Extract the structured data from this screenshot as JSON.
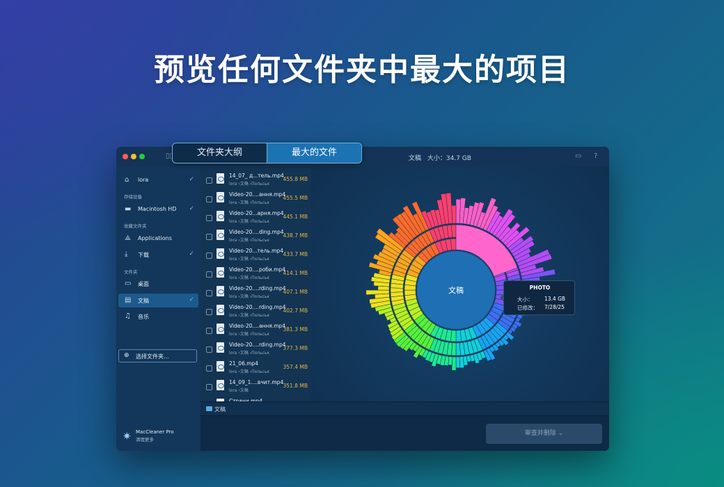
{
  "banner": {
    "title": "预览任何文件夹中最大的项目"
  },
  "window": {
    "tabs": [
      "文件夹大纲",
      "最大的文件"
    ],
    "active_tab": 1,
    "folder_name": "文稿",
    "size_label": "大小：34.7 GB",
    "icons": [
      "sidebar-toggle-icon",
      "chat-bubble-icon",
      "help-icon"
    ]
  },
  "sidebar": {
    "user": {
      "label": "lora",
      "icon": "home-icon",
      "checked": true
    },
    "storage_header": "存储设备",
    "storage": [
      {
        "label": "Macintosh HD",
        "icon": "drive-icon",
        "checked": true
      }
    ],
    "favorites_header": "收藏文件夹",
    "favorites": [
      {
        "label": "Applications",
        "icon": "apps-icon",
        "checked": false
      },
      {
        "label": "下载",
        "icon": "download-icon",
        "checked": true
      }
    ],
    "folders_header": "文件夹",
    "folders": [
      {
        "label": "桌面",
        "icon": "desktop-icon",
        "checked": false
      },
      {
        "label": "文稿",
        "icon": "document-icon",
        "checked": true,
        "selected": true
      },
      {
        "label": "音乐",
        "icon": "music-icon",
        "checked": false
      }
    ],
    "choose_folder": "选择文件夹...",
    "brand_name": "MacCleaner Pro",
    "brand_sub": "清理更多"
  },
  "files": [
    {
      "name": "14_07_ д...тель.mp4",
      "path": "lora ›文稿 ›Польськ",
      "size": "455.8 MB"
    },
    {
      "name": "Video-20....ання.mp4",
      "path": "lora ›文稿 ›Польськ",
      "size": "455.5 MB"
    },
    {
      "name": "Video-20...арня.mp4",
      "path": "lora ›文稿 ›Польськ",
      "size": "445.1 MB"
    },
    {
      "name": "Video-20....ding.mp4",
      "path": "lora ›文稿 ›Польськ",
      "size": "438.7 MB"
    },
    {
      "name": "Video-20...тель.mp4",
      "path": "lora ›文稿 ›Польськ",
      "size": "433.7 MB"
    },
    {
      "name": "Video-20....роби.mp4",
      "path": "lora ›文稿 ›Польськ",
      "size": "414.1 MB"
    },
    {
      "name": "Video-20....rding.mp4",
      "path": "lora ›文稿 ›Польськ",
      "size": "407.1 MB"
    },
    {
      "name": "Video-20....rding.mp4",
      "path": "lora ›文稿 ›Польськ",
      "size": "402.7 MB"
    },
    {
      "name": "Video-20....ання.mp4",
      "path": "lora ›文稿 ›Польськ",
      "size": "381.3 MB"
    },
    {
      "name": "Video-20....rding.mp4",
      "path": "lora ›文稿 ›Польськ",
      "size": "377.3 MB"
    },
    {
      "name": "21_06.mp4",
      "path": "lora ›文稿 ›Польськ",
      "size": "357.4 MB"
    },
    {
      "name": "14_09_1....вчит.mp4",
      "path": "lora ›文稿",
      "size": "351.8 MB"
    },
    {
      "name": "Страни.mp4",
      "path": "",
      "size": ""
    }
  ],
  "pathbar": {
    "label": "文稿"
  },
  "footer": {
    "review_button": "审查并删除 ⌄"
  },
  "sunburst": {
    "center_label": "文稿",
    "colors": [
      "#ff5fc8",
      "#e050f0",
      "#b44cf5",
      "#7a55f2",
      "#3d6ff2",
      "#1aa3f0",
      "#12d0d8",
      "#20e890",
      "#58f03a",
      "#b8f020",
      "#f0e01e",
      "#ffa51c",
      "#ff6a2a",
      "#ff3f6e"
    ]
  },
  "tooltip": {
    "title": "PHOTO",
    "size_label": "大小：",
    "size_value": "13.4 GB",
    "modified_label": "已修改：",
    "modified_value": "7/28/25"
  }
}
